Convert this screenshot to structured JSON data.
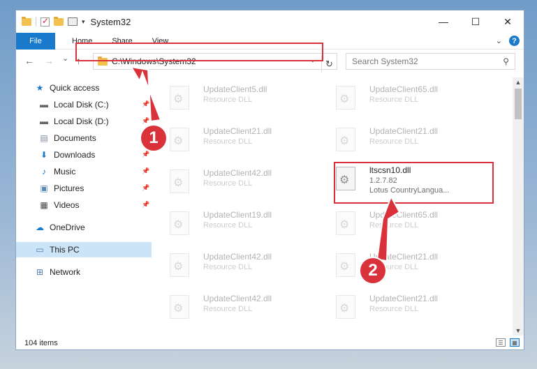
{
  "window": {
    "title": "System32"
  },
  "ribbon": {
    "file_tab": "File",
    "tabs": [
      "Home",
      "Share",
      "View"
    ],
    "help": "?"
  },
  "window_controls": {
    "minimize": "—",
    "maximize": "☐",
    "close": "✕"
  },
  "nav": {
    "back": "←",
    "forward": "→",
    "recent": "⌄",
    "up": "↑",
    "address": "C:\\Windows\\System32",
    "refresh": "↻",
    "search_placeholder": "Search System32"
  },
  "sidebar": {
    "items": [
      {
        "label": "Quick access",
        "icon": "star-icon"
      },
      {
        "label": "Local Disk (C:)",
        "icon": "drive-icon"
      },
      {
        "label": "Local Disk (D:)",
        "icon": "drive-icon"
      },
      {
        "label": "Documents",
        "icon": "documents-icon"
      },
      {
        "label": "Downloads",
        "icon": "download-icon"
      },
      {
        "label": "Music",
        "icon": "music-icon"
      },
      {
        "label": "Pictures",
        "icon": "pictures-icon"
      },
      {
        "label": "Videos",
        "icon": "videos-icon"
      },
      {
        "label": "OneDrive",
        "icon": "cloud-icon"
      },
      {
        "label": "This PC",
        "icon": "computer-icon"
      },
      {
        "label": "Network",
        "icon": "network-icon"
      }
    ]
  },
  "files": {
    "left": [
      {
        "name": "UpdateClient5.dll",
        "type": "Resource DLL"
      },
      {
        "name": "UpdateClient21.dll",
        "type": "Resource DLL"
      },
      {
        "name": "UpdateClient42.dll",
        "type": "Resource DLL"
      },
      {
        "name": "UpdateClient19.dll",
        "type": "Resource DLL"
      },
      {
        "name": "UpdateClient42.dll",
        "type": "Resource DLL"
      },
      {
        "name": "UpdateClient42.dll",
        "type": "Resource DLL"
      }
    ],
    "right": [
      {
        "name": "UpdateClient65.dll",
        "type": "Resource DLL"
      },
      {
        "name": "UpdateClient21.dll",
        "type": "Resource DLL"
      },
      {
        "name": "ltscsn10.dll",
        "type": "1.2.7.82",
        "desc": "Lotus CountryLangua..."
      },
      {
        "name": "UpdateClient65.dll",
        "type": "Resource DLL"
      },
      {
        "name": "UpdateClient21.dll",
        "type": "Resource DLL"
      },
      {
        "name": "UpdateClient21.dll",
        "type": "Resource DLL"
      }
    ]
  },
  "status": {
    "items_count": "104 items"
  },
  "callouts": {
    "one": "1",
    "two": "2"
  },
  "colors": {
    "accent": "#1979ca",
    "highlight": "#d9323b",
    "selected": "#cce4f7"
  }
}
